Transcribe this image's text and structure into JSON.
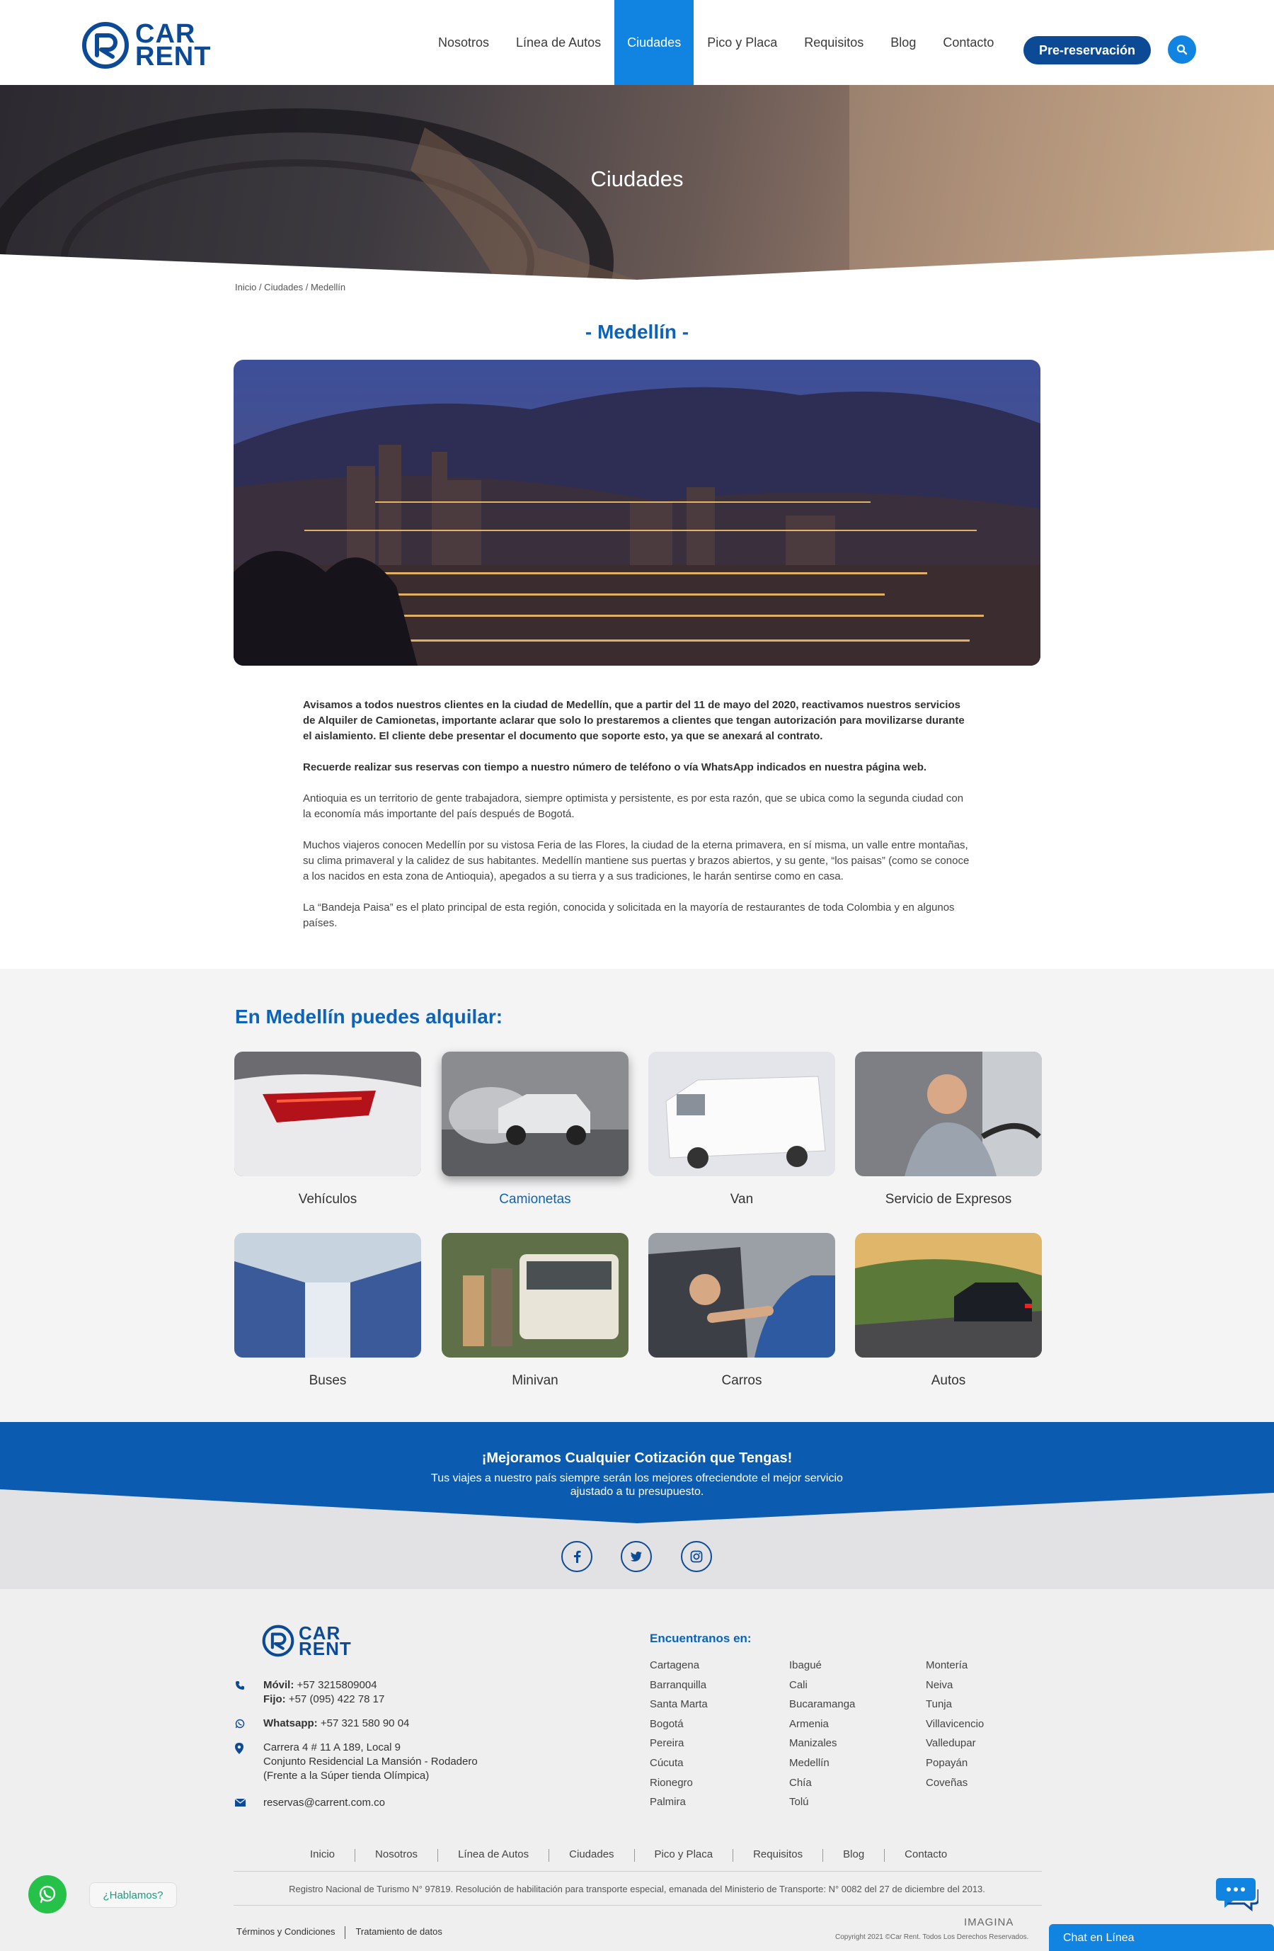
{
  "header": {
    "logo_line1": "CAR",
    "logo_line2": "RENT",
    "nav": [
      "Nosotros",
      "Línea de Autos",
      "Ciudades",
      "Pico y Placa",
      "Requisitos",
      "Blog",
      "Contacto"
    ],
    "active_nav": "Ciudades",
    "cta_label": "Pre-reservación"
  },
  "hero": {
    "title": "Ciudades"
  },
  "breadcrumb": "Inicio / Ciudades / Medellín",
  "city": {
    "title": "- Medellín -",
    "paragraphs": [
      "Avisamos a todos nuestros clientes en la ciudad de Medellín, que a partir del 11 de mayo del 2020, reactivamos nuestros servicios de Alquiler de Camionetas, importante aclarar que solo  lo prestaremos a clientes que tengan autorización para movilizarse durante el aislamiento. El cliente debe presentar el documento que soporte esto, ya que se anexará al contrato.",
      "Recuerde realizar sus reservas con tiempo a nuestro número de teléfono o vía WhatsApp indicados en nuestra página web.",
      "Antioquia es un territorio de gente trabajadora, siempre optimista y persistente, es por esta razón, que se ubica como la segunda ciudad con la economía más importante del país después de Bogotá.",
      "Muchos viajeros conocen Medellín por su vistosa Feria de las Flores, la ciudad de la eterna primavera, en sí misma, un valle entre montañas, su clima primaveral y la calidez de sus habitantes. Medellín mantiene sus puertas y brazos abiertos, y su gente, “los paisas” (como se conoce a los nacidos en esta zona de Antioquia), apegados a su tierra y a sus tradiciones, le harán sentirse como en casa.",
      "La “Bandeja Paisa” es el plato principal de esta región, conocida y solicitada en la mayoría de restaurantes de toda Colombia y en algunos países."
    ]
  },
  "rent": {
    "title": "En Medellín puedes alquilar:",
    "items": [
      "Vehículos",
      "Camionetas",
      "Van",
      "Servicio de Expresos",
      "Buses",
      "Minivan",
      "Carros",
      "Autos"
    ],
    "highlighted": "Camionetas"
  },
  "promo": {
    "title": "¡Mejoramos Cualquier Cotización que Tengas!",
    "text": "Tus viajes a nuestro país siempre serán los mejores ofreciendote el mejor servicio ajustado a tu presupuesto."
  },
  "footer": {
    "movil_label": "Móvil:",
    "movil": "+57 3215809004",
    "fijo_label": "Fijo:",
    "fijo": "+57 (095) 422 78 17",
    "whatsapp_label": "Whatsapp:",
    "whatsapp": "+57 321 580 90 04",
    "address_1": "Carrera 4 # 11 A 189, Local 9",
    "address_2": "Conjunto Residencial La Mansión - Rodadero",
    "address_3": "(Frente a la Súper tienda Olímpica)",
    "email": "reservas@carrent.com.co",
    "cities_title": "Encuentranos en:",
    "cities_col1": [
      "Cartagena",
      "Barranquilla",
      "Santa Marta",
      "Bogotá",
      "Pereira",
      "Cúcuta",
      "Rionegro",
      "Palmira"
    ],
    "cities_col2": [
      "Ibagué",
      "Cali",
      "Bucaramanga",
      "Armenia",
      "Manizales",
      "Medellín",
      "Chía",
      "Tolú"
    ],
    "cities_col3": [
      "Montería",
      "Neiva",
      "Tunja",
      "Villavicencio",
      "Valledupar",
      "Popayán",
      "Coveñas"
    ],
    "nav": [
      "Inicio",
      "Nosotros",
      "Línea de Autos",
      "Ciudades",
      "Pico y Placa",
      "Requisitos",
      "Blog",
      "Contacto"
    ],
    "registro": "Registro Nacional de Turismo N° 97819. Resolución de habilitación para transporte especial, emanada del Ministerio de Transporte: N° 0082 del 27 de diciembre del 2013.",
    "terms": "Términos y Condiciones",
    "privacy": "Tratamiento de datos",
    "agency": "IMAGINA",
    "copyright": "Copyright 2021 ©Car Rent. Todos Los Derechos Reservados."
  },
  "widgets": {
    "whatsapp_bubble": "¿Hablamos?",
    "chat_bar": "Chat en Línea"
  },
  "colors": {
    "brand_dark": "#0d4a96",
    "brand_blue": "#1183e0",
    "title_blue": "#0d63b8",
    "whatsapp": "#25c149"
  }
}
